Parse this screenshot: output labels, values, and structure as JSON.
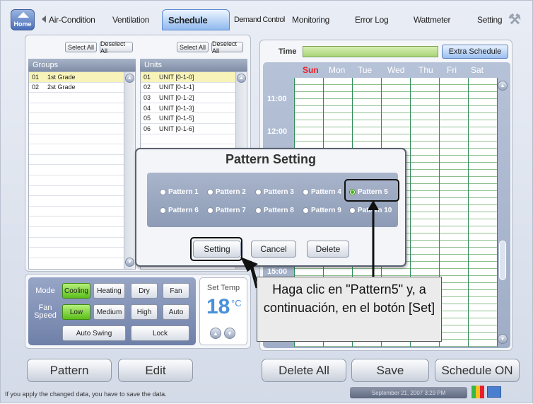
{
  "nav": {
    "home_label": "Home",
    "tabs": [
      "Air-Condition",
      "Ventilation",
      "Schedule",
      "Demand Control",
      "Monitoring",
      "Error Log",
      "Wattmeter",
      "Setting"
    ],
    "active_tab": "Schedule"
  },
  "groups": {
    "select_all": "Select All",
    "deselect_all": "Deselect All",
    "header": "Groups",
    "items": [
      {
        "num": "01",
        "name": "1st Grade",
        "selected": true
      },
      {
        "num": "02",
        "name": "2st Grade",
        "selected": false
      }
    ]
  },
  "units": {
    "select_all": "Select All",
    "deselect_all": "Deselect All",
    "header": "Units",
    "items": [
      {
        "num": "01",
        "name": "UNIT [0-1-0]",
        "selected": true
      },
      {
        "num": "02",
        "name": "UNIT [0-1-1]"
      },
      {
        "num": "03",
        "name": "UNIT [0-1-2]"
      },
      {
        "num": "04",
        "name": "UNIT [0-1-3]"
      },
      {
        "num": "05",
        "name": "UNIT [0-1-5]"
      },
      {
        "num": "06",
        "name": "UNIT [0-1-6]"
      }
    ]
  },
  "mode": {
    "mode_label": "Mode",
    "modes": [
      "Cooling",
      "Heating",
      "Dry",
      "Fan"
    ],
    "active_mode": "Cooling",
    "fan_label": "Fan Speed",
    "fan_speeds": [
      "Low",
      "Medium",
      "High",
      "Auto"
    ],
    "active_fan": "Low",
    "auto_swing": "Auto Swing",
    "lock": "Lock"
  },
  "temp": {
    "label": "Set Temp",
    "value": "18",
    "unit": "°C"
  },
  "schedule": {
    "time_label": "Time",
    "extra_label": "Extra Schedule",
    "days": [
      "Sun",
      "Mon",
      "Tue",
      "Wed",
      "Thu",
      "Fri",
      "Sat"
    ],
    "times": [
      "11:00",
      "12:00",
      "15:00"
    ]
  },
  "modal": {
    "title": "Pattern Setting",
    "patterns": [
      "Pattern 1",
      "Pattern 2",
      "Pattern 3",
      "Pattern 4",
      "Pattern 5",
      "Pattern 6",
      "Pattern 7",
      "Pattern 8",
      "Pattern 9",
      "Pattern 10"
    ],
    "selected_pattern": "Pattern 5",
    "setting": "Setting",
    "cancel": "Cancel",
    "delete": "Delete"
  },
  "callout": {
    "text": "Haga clic en \"Pattern5\" y, a continuación, en el botón [Set]"
  },
  "bottom": {
    "pattern": "Pattern",
    "edit": "Edit",
    "delete_all": "Delete All",
    "save": "Save",
    "schedule_on": "Schedule ON"
  },
  "status": {
    "message": "If you apply the changed data, you have to save the data.",
    "datetime": "September 21, 2007 3:29 PM"
  },
  "colors": {
    "accent": "#7ab7f0",
    "active_green": "#5cbf1c",
    "sunday": "#e8202a",
    "highlight": "#f8f3b8"
  }
}
